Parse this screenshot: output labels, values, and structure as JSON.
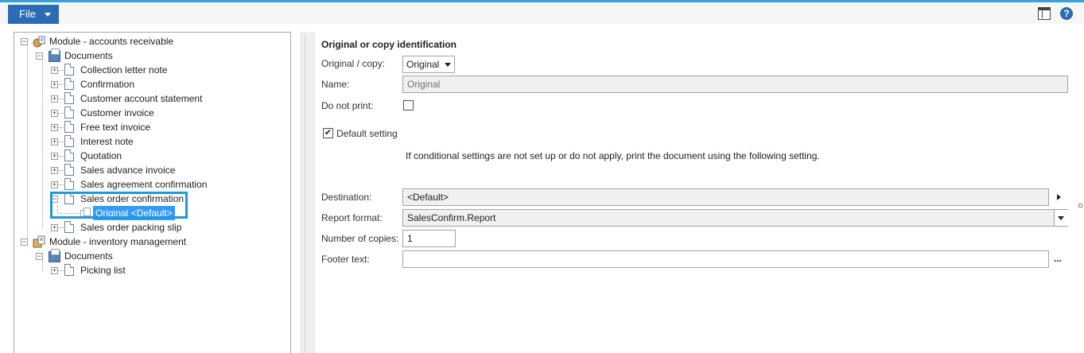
{
  "toolbar": {
    "file_label": "File",
    "layout_icon": "layout-icon",
    "help_icon": "help-icon",
    "help_glyph": "?"
  },
  "tree": {
    "nodes": [
      {
        "label": "Module - accounts receivable",
        "icon": "module-ar-icon",
        "expander": "−"
      },
      {
        "label": "Documents",
        "icon": "documents-icon",
        "expander": "−"
      },
      {
        "label": "Collection letter note",
        "icon": "document-icon",
        "expander": "+"
      },
      {
        "label": "Confirmation",
        "icon": "document-icon",
        "expander": "+"
      },
      {
        "label": "Customer account statement",
        "icon": "document-icon",
        "expander": "+"
      },
      {
        "label": "Customer invoice",
        "icon": "document-icon",
        "expander": "+"
      },
      {
        "label": "Free text invoice",
        "icon": "document-icon",
        "expander": "+"
      },
      {
        "label": "Interest note",
        "icon": "document-icon",
        "expander": "+"
      },
      {
        "label": "Quotation",
        "icon": "document-icon",
        "expander": "+"
      },
      {
        "label": "Sales advance invoice",
        "icon": "document-icon",
        "expander": "+"
      },
      {
        "label": "Sales agreement confirmation",
        "icon": "document-icon",
        "expander": "+"
      },
      {
        "label": "Sales order confirmation",
        "icon": "document-icon",
        "expander": "−"
      },
      {
        "label": "Original <Default>",
        "icon": "setting-icon",
        "expander": ""
      },
      {
        "label": "Sales order packing slip",
        "icon": "document-icon",
        "expander": "+"
      },
      {
        "label": "Module - inventory management",
        "icon": "module-inventory-icon",
        "expander": "−"
      },
      {
        "label": "Documents",
        "icon": "documents-icon",
        "expander": "−"
      },
      {
        "label": "Picking list",
        "icon": "document-icon",
        "expander": "+"
      }
    ]
  },
  "form": {
    "section_title": "Original or copy identification",
    "original_copy_label": "Original / copy:",
    "original_copy_value": "Original",
    "name_label": "Name:",
    "name_value": "Original",
    "do_not_print_label": "Do not print:",
    "do_not_print_checked": false,
    "default_setting_label": "Default setting",
    "default_setting_checked": true,
    "check_glyph": "✔",
    "note": "If conditional settings are not set up or do not apply, print the document using the following setting.",
    "destination_label": "Destination:",
    "destination_value": "<Default>",
    "report_format_label": "Report format:",
    "report_format_value": "SalesConfirm.Report",
    "copies_label": "Number of copies:",
    "copies_value": "1",
    "footer_label": "Footer text:",
    "footer_value": "",
    "footer_lookup": "..."
  },
  "colors": {
    "accent": "#33a5dd",
    "file_button": "#2a6cb5",
    "selection": "#3399ff",
    "focus_frame": "#1d9ad9"
  }
}
